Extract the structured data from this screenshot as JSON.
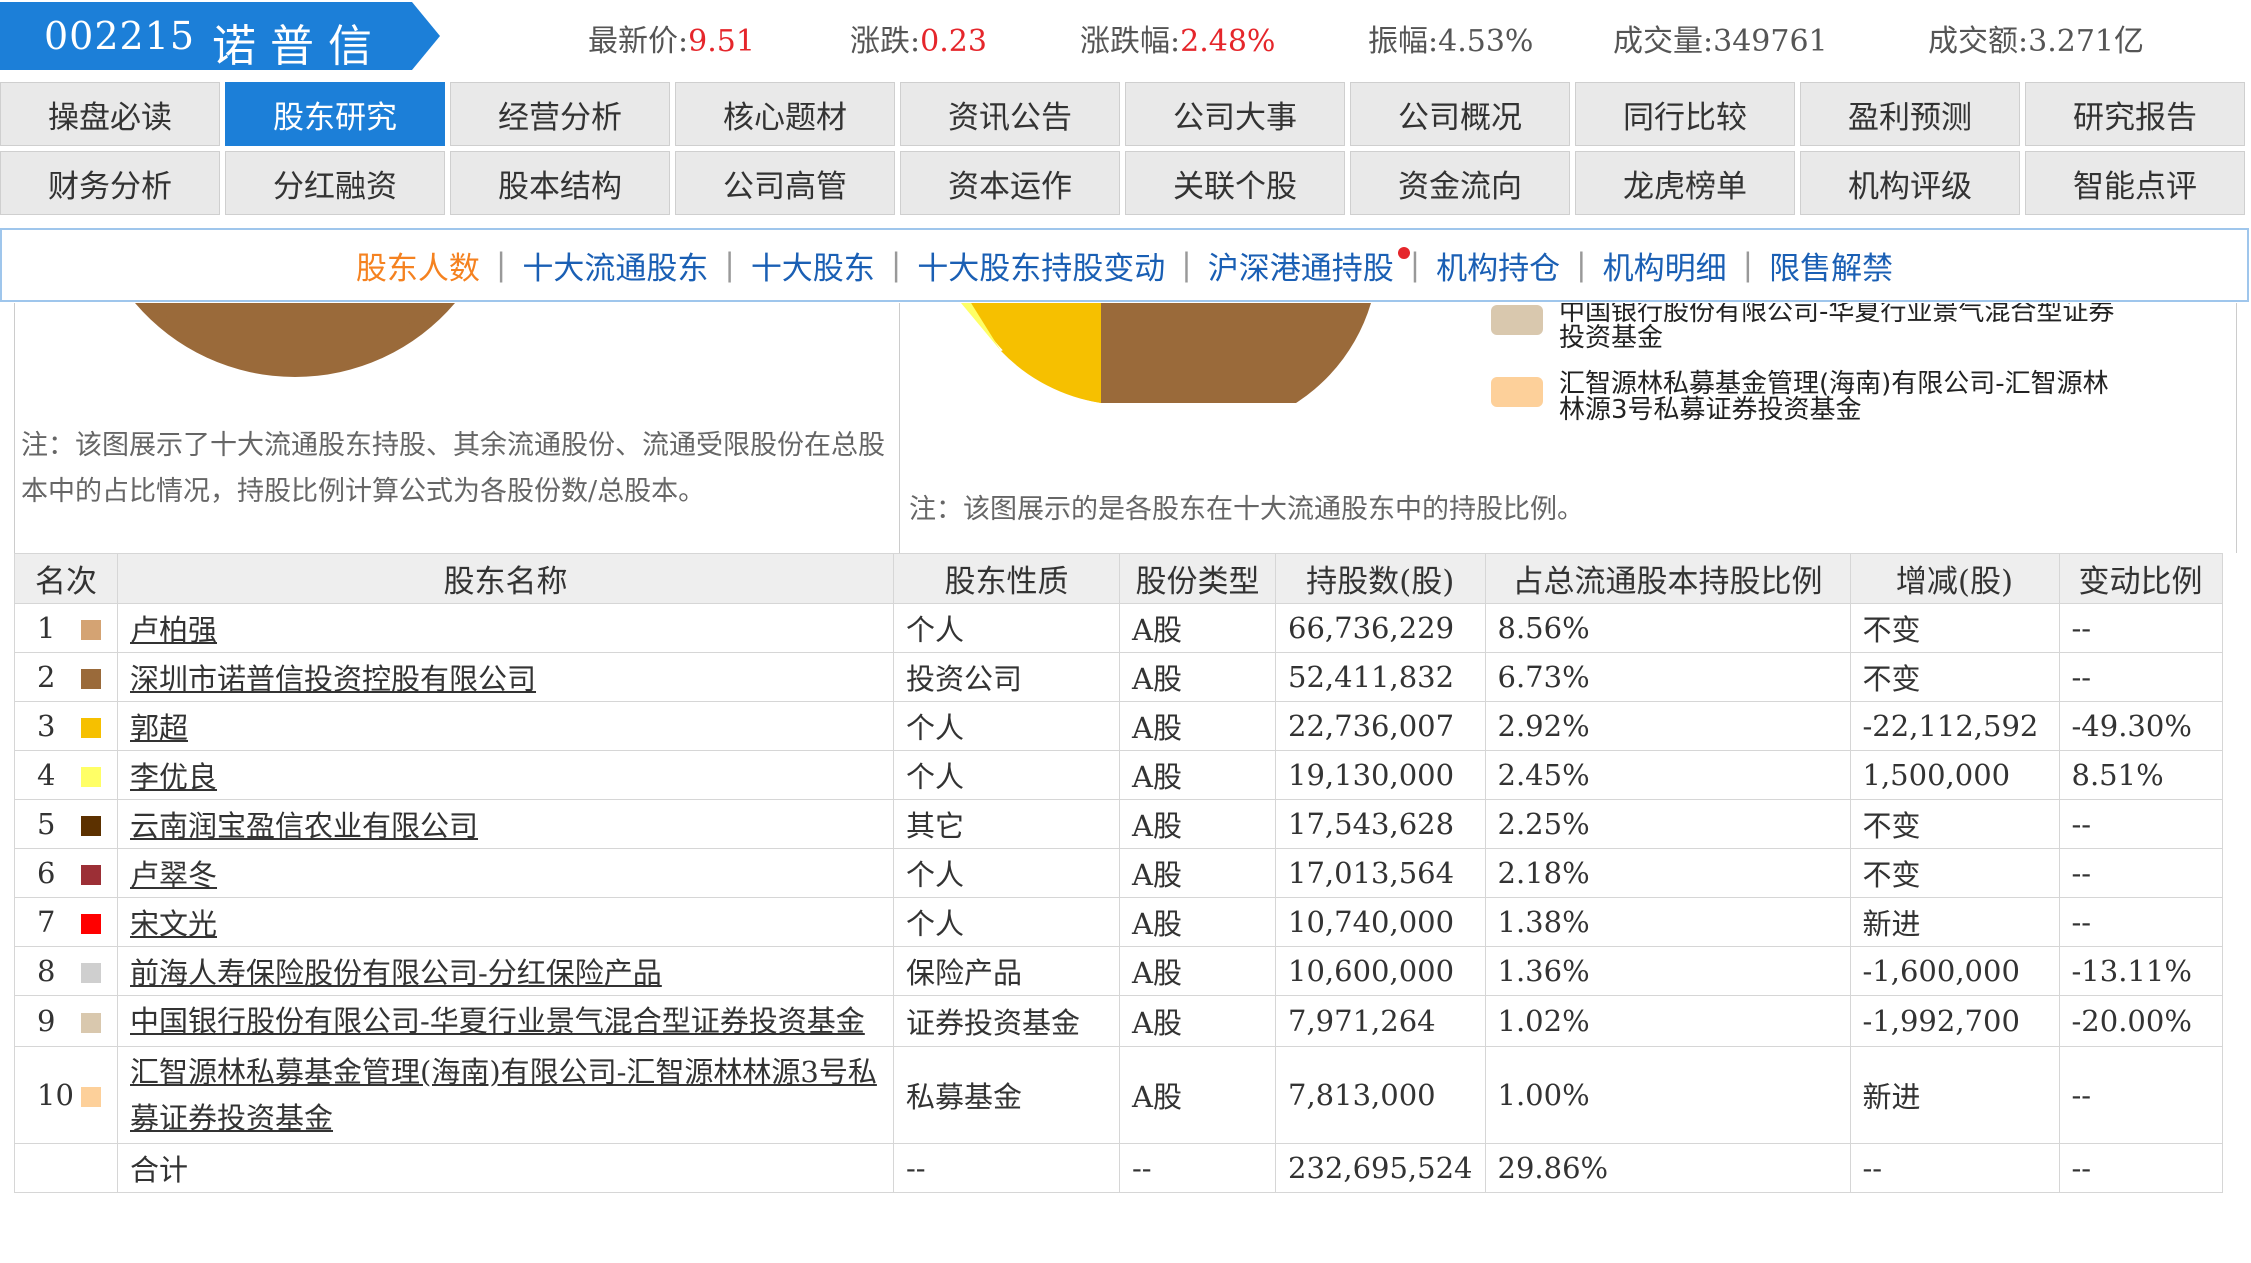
{
  "header": {
    "code": "002215",
    "name": "诺普信",
    "quotes": [
      {
        "label": "最新价:",
        "value": "9.51",
        "color": "red"
      },
      {
        "label": "涨跌:",
        "value": "0.23",
        "color": "red"
      },
      {
        "label": "涨跌幅:",
        "value": "2.48%",
        "color": "red"
      },
      {
        "label": "振幅:",
        "value": "4.53%",
        "color": "plain"
      },
      {
        "label": "成交量:",
        "value": "349761",
        "color": "plain"
      },
      {
        "label": "成交额:",
        "value": "3.271亿",
        "color": "plain"
      }
    ]
  },
  "nav": {
    "row1": [
      "操盘必读",
      "股东研究",
      "经营分析",
      "核心题材",
      "资讯公告",
      "公司大事",
      "公司概况",
      "同行比较",
      "盈利预测",
      "研究报告"
    ],
    "row2": [
      "财务分析",
      "分红融资",
      "股本结构",
      "公司高管",
      "资本运作",
      "关联个股",
      "资金流向",
      "龙虎榜单",
      "机构评级",
      "智能点评"
    ],
    "active": "股东研究"
  },
  "subnav": {
    "items": [
      "股东人数",
      "十大流通股东",
      "十大股东",
      "十大股东持股变动",
      "沪深港通持股",
      "机构持仓",
      "机构明细",
      "限售解禁"
    ],
    "active": "股东人数",
    "separator": "|"
  },
  "panels": {
    "left_note": "注：该图展示了十大流通股东持股、其余流通股份、流通受限股份在总股本中的占比情况，持股比例计算公式为各股份数/总股本。",
    "right_note": "注：该图展示的是各股东在十大流通股东中的持股比例。",
    "legend": [
      {
        "text": "中国银行股份有限公司-华夏行业景气混合型证券投资基金",
        "color": "#d9c8ae"
      },
      {
        "text": "汇智源林私募基金管理(海南)有限公司-汇智源林林源3号私募证券投资基金",
        "color": "#fdd09a"
      }
    ]
  },
  "table": {
    "headers": [
      "名次",
      "股东名称",
      "股东性质",
      "股份类型",
      "持股数(股)",
      "占总流通股本持股比例",
      "增减(股)",
      "变动比例"
    ],
    "rows": [
      {
        "rank": "1",
        "color": "#d4a373",
        "name": "卢柏强",
        "nature": "个人",
        "type": "A股",
        "shares": "66,736,229",
        "ratio": "8.56%",
        "change": "不变",
        "change_pct": "--",
        "tone": "plain"
      },
      {
        "rank": "2",
        "color": "#9a6a3a",
        "name": "深圳市诺普信投资控股有限公司",
        "nature": "投资公司",
        "type": "A股",
        "shares": "52,411,832",
        "ratio": "6.73%",
        "change": "不变",
        "change_pct": "--",
        "tone": "plain"
      },
      {
        "rank": "3",
        "color": "#f6c000",
        "name": "郭超",
        "nature": "个人",
        "type": "A股",
        "shares": "22,736,007",
        "ratio": "2.92%",
        "change": "-22,112,592",
        "change_pct": "-49.30%",
        "tone": "green"
      },
      {
        "rank": "4",
        "color": "#ffff66",
        "name": "李优良",
        "nature": "个人",
        "type": "A股",
        "shares": "19,130,000",
        "ratio": "2.45%",
        "change": "1,500,000",
        "change_pct": "8.51%",
        "tone": "red"
      },
      {
        "rank": "5",
        "color": "#5c3100",
        "name": "云南润宝盈信农业有限公司",
        "nature": "其它",
        "type": "A股",
        "shares": "17,543,628",
        "ratio": "2.25%",
        "change": "不变",
        "change_pct": "--",
        "tone": "plain"
      },
      {
        "rank": "6",
        "color": "#9c2f36",
        "name": "卢翠冬",
        "nature": "个人",
        "type": "A股",
        "shares": "17,013,564",
        "ratio": "2.18%",
        "change": "不变",
        "change_pct": "--",
        "tone": "plain"
      },
      {
        "rank": "7",
        "color": "#ff0000",
        "name": "宋文光",
        "nature": "个人",
        "type": "A股",
        "shares": "10,740,000",
        "ratio": "1.38%",
        "change": "新进",
        "change_pct": "--",
        "tone": "red"
      },
      {
        "rank": "8",
        "color": "#cfcfcf",
        "name": "前海人寿保险股份有限公司-分红保险产品",
        "nature": "保险产品",
        "type": "A股",
        "shares": "10,600,000",
        "ratio": "1.36%",
        "change": "-1,600,000",
        "change_pct": "-13.11%",
        "tone": "green"
      },
      {
        "rank": "9",
        "color": "#d9c8ae",
        "name": "中国银行股份有限公司-华夏行业景气混合型证券投资基金",
        "nature": "证券投资基金",
        "type": "A股",
        "shares": "7,971,264",
        "ratio": "1.02%",
        "change": "-1,992,700",
        "change_pct": "-20.00%",
        "tone": "green"
      },
      {
        "rank": "10",
        "color": "#fdd09a",
        "name": "汇智源林私募基金管理(海南)有限公司-汇智源林林源3号私募证券投资基金",
        "nature": "私募基金",
        "type": "A股",
        "shares": "7,813,000",
        "ratio": "1.00%",
        "change": "新进",
        "change_pct": "--",
        "tone": "red"
      }
    ],
    "total": {
      "label": "合计",
      "nature": "--",
      "type": "--",
      "shares": "232,695,524",
      "ratio": "29.86%",
      "change": "--",
      "change_pct": "--"
    }
  },
  "colors": {
    "brand_blue": "#1c7fd8",
    "up_red": "#e5262b",
    "down_green": "#1a9c2e",
    "link_orange": "#f58220"
  }
}
